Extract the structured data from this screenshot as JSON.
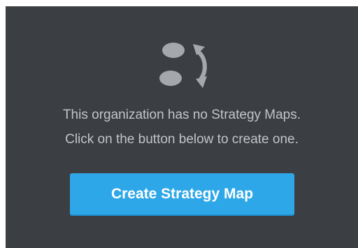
{
  "empty_state": {
    "icon": "strategy-map-empty-icon",
    "message_line_1": "This organization has no Strategy Maps.",
    "message_line_2": "Click on the button below to create one."
  },
  "actions": {
    "create_label": "Create Strategy Map"
  },
  "colors": {
    "panel_background": "#3b3e42",
    "icon_color": "#a4a8ac",
    "text_color": "#c2c5c8",
    "button_background": "#2ea7e8",
    "button_text": "#ffffff"
  }
}
